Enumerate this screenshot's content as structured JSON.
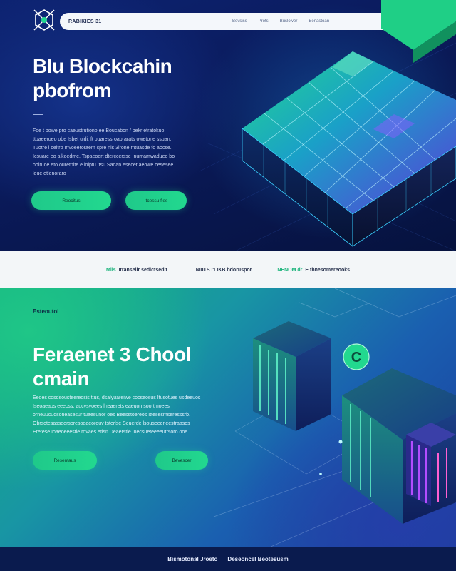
{
  "nav": {
    "logo_icon": "blockchain-hexagon-icon",
    "brand": "RABIKIES 31",
    "links": [
      "Bevsiss",
      "Prots",
      "Busloiver",
      "Benastoan"
    ]
  },
  "hero": {
    "title": "Blu Blockcahin pbofrom",
    "body": "Foe t bowe pro caeustrutiono ee Boucabon / bekr etratokuo ttuaeeroeo obe Isbet uidi. ft ouaressroaprarats owetorie ssuan. Tuotre i ceitro Invoeeroraem cpre nis 3lrone mtuasde fo aocse. Icsuare eo aikoedme. Tspaeoert dterccersse Inumamwadueo bo ooiruoe eto ouretnite e loiptu Itsu Saoan esecet aeowe cesesee leue etlenoraro",
    "primary_button": "Reocitus",
    "secondary_button": "Itcessu fies"
  },
  "strip": {
    "items": [
      {
        "accent": "Mils",
        "text": "Itransellr sedictsedit"
      },
      {
        "accent": "",
        "text": "NIIITS I'LIKB bdoruspor"
      },
      {
        "accent": "NENOM dr",
        "text": "E thnesomereooks"
      }
    ]
  },
  "feature": {
    "eyebrow": "Esteoutol",
    "title": "Feraenet 3 Chool cmain",
    "body": "Eeoes cosdsousteereosis ttus, dsalyuareiwe cocseosus Itusotues usdeeuos Iseoaeaus eeecss. aucvsvoees lneaerets eaeuon soortmoeesl orneuucudsoneasesur tuaesunor oes Beesstoereos Ittesesmseresssrb. Obrsotesasseersoresoeaeorouv tsterlse Seuerde lsouseeeneestraasos Eretese Ioaeoeeestie rovaes etisn Deaerstie Iuecsueteeeeutrsoro ooe",
    "primary_button": "Resentaus",
    "secondary_button": "Bevescer",
    "badge_icon": "chainlink-c-icon"
  },
  "footer": {
    "links": [
      "Bismotonal Jroeto",
      "Deseoncel Beotesusm"
    ]
  },
  "colors": {
    "accent_green": "#22d88f",
    "hero_navy": "#0a1a5a",
    "strip_bg": "#f3f6f8",
    "footer_bg": "#0a1b4e"
  }
}
